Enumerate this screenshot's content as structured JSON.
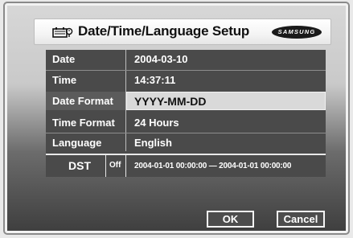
{
  "header": {
    "title": "Date/Time/Language Setup",
    "logo_text": "SAMSUNG",
    "icon": "calendar-clock-icon"
  },
  "settings": {
    "rows": [
      {
        "label": "Date",
        "value": "2004-03-10"
      },
      {
        "label": "Time",
        "value": "14:37:11"
      },
      {
        "label": "Date Format",
        "value": "YYYY-MM-DD",
        "selected": true
      },
      {
        "label": "Time Format",
        "value": "24 Hours"
      },
      {
        "label": "Language",
        "value": "English"
      }
    ],
    "dst": {
      "label": "DST",
      "state": "Off",
      "range": "2004-01-01 00:00:00  —  2004-01-01 00:00:00"
    }
  },
  "buttons": {
    "ok": "OK",
    "cancel": "Cancel"
  },
  "colors": {
    "panel": "#4a4a4a",
    "selected_value_bg": "#d9d9d9",
    "selected_label_bg": "#5b5b5b"
  }
}
